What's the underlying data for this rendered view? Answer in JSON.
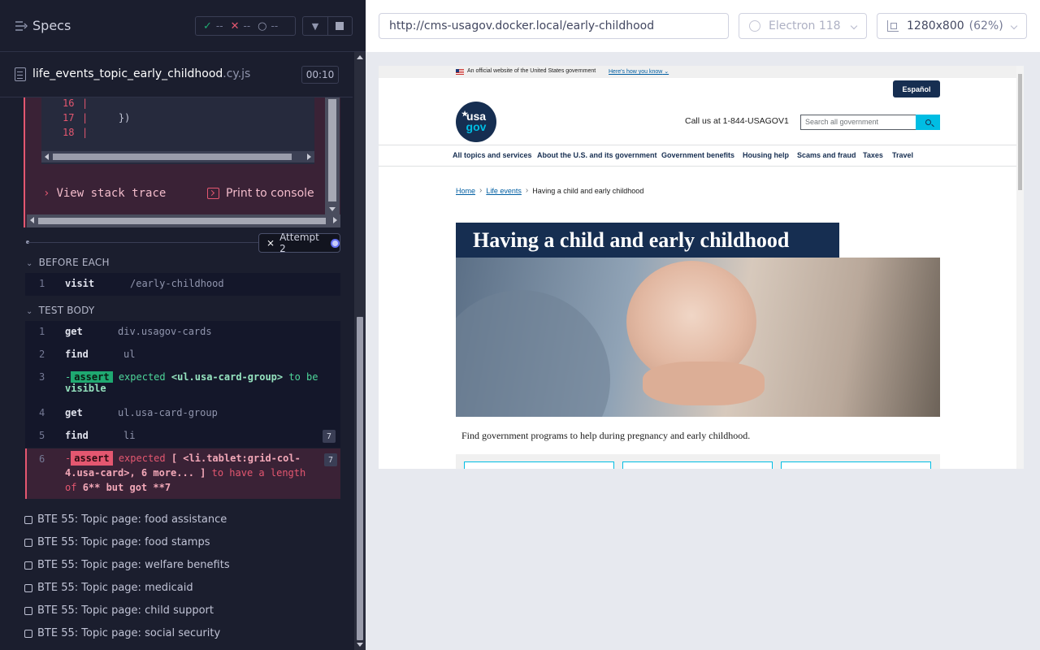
{
  "reporter": {
    "header": {
      "title": "Specs",
      "stats": {
        "passed": "--",
        "failed": "--",
        "pending": "--"
      }
    },
    "spec_file": {
      "name": "life_events_topic_early_childhood",
      "ext": ".cy.js",
      "duration": "00:10"
    },
    "error": {
      "code_lines": [
        {
          "line": "16",
          "code": ""
        },
        {
          "line": "17",
          "code": "    })"
        },
        {
          "line": "18",
          "code": ""
        }
      ],
      "view_stack_trace": "View stack trace",
      "print_to_console": "Print to console"
    },
    "attempt_label": "Attempt 2",
    "before_each": {
      "title": "BEFORE EACH",
      "commands": [
        {
          "num": "1",
          "name": "visit",
          "arg": "/early-childhood"
        }
      ]
    },
    "test_body": {
      "title": "TEST BODY",
      "cmd1": {
        "num": "1",
        "name": "get",
        "arg": "div.usagov-cards"
      },
      "cmd2": {
        "num": "2",
        "name": "find",
        "arg": "ul"
      },
      "cmd3": {
        "num": "3",
        "prefix": "-",
        "tag": "assert",
        "w1": "expected",
        "w2": "<ul.usa-card-group>",
        "w3": "to be",
        "w4": "visible"
      },
      "cmd4": {
        "num": "4",
        "name": "get",
        "arg": "ul.usa-card-group"
      },
      "cmd5": {
        "num": "5",
        "name": "find",
        "arg": "li",
        "count": "7"
      },
      "cmd6": {
        "num": "6",
        "prefix": "-",
        "tag": "assert",
        "w1": "expected",
        "w2": "[ <li.tablet:grid-col-",
        "w3": "4.usa-card>, 6 more... ]",
        "w4": "to have a length",
        "w5": "of",
        "w6": "6** but got **7",
        "count": "7"
      }
    },
    "other_tests": [
      "BTE 55: Topic page: food assistance",
      "BTE 55: Topic page: food stamps",
      "BTE 55: Topic page: welfare benefits",
      "BTE 55: Topic page: medicaid",
      "BTE 55: Topic page: child support",
      "BTE 55: Topic page: social security"
    ]
  },
  "aut": {
    "url": "http://cms-usagov.docker.local/early-childhood",
    "browser": "Electron 118",
    "viewport": "1280x800",
    "viewport_pct": "(62%)",
    "page": {
      "banner_text": "An official website of the United States government",
      "banner_link": "Here's how you know",
      "espanol": "Español",
      "logo_top": "usa",
      "logo_bottom": "gov",
      "call_us": "Call us at 1-844-USAGOV1",
      "search_placeholder": "Search all government",
      "nav": [
        "All topics and services",
        "About the U.S. and its government",
        "Government benefits",
        "Housing help",
        "Scams and fraud",
        "Taxes",
        "Travel"
      ],
      "breadcrumb": {
        "home": "Home",
        "life_events": "Life events",
        "current": "Having a child and early childhood"
      },
      "title": "Having a child and early childhood",
      "intro": "Find government programs to help during pregnancy and early childhood."
    }
  },
  "colors": {
    "reporter_bg": "#1b1e2e",
    "pass": "#1fa971",
    "fail": "#e45770",
    "usa_navy": "#162e51",
    "usa_cyan": "#00bde3"
  }
}
